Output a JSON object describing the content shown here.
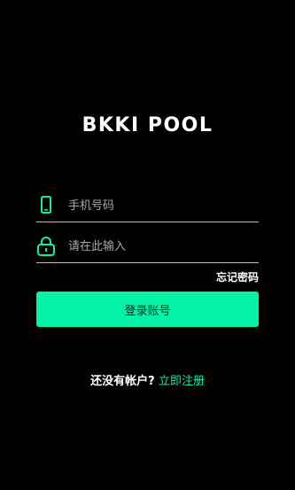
{
  "brand": {
    "logo_text": "BKKI POOL",
    "accent_color": "#04f2a6"
  },
  "form": {
    "phone_placeholder": "手机号码",
    "phone_icon": "phone-icon",
    "password_placeholder": "请在此输入",
    "password_icon": "lock-icon",
    "forgot_label": "忘记密码",
    "login_label": "登录账号"
  },
  "register": {
    "prompt": "还没有帐户?",
    "link_label": "立即注册"
  }
}
